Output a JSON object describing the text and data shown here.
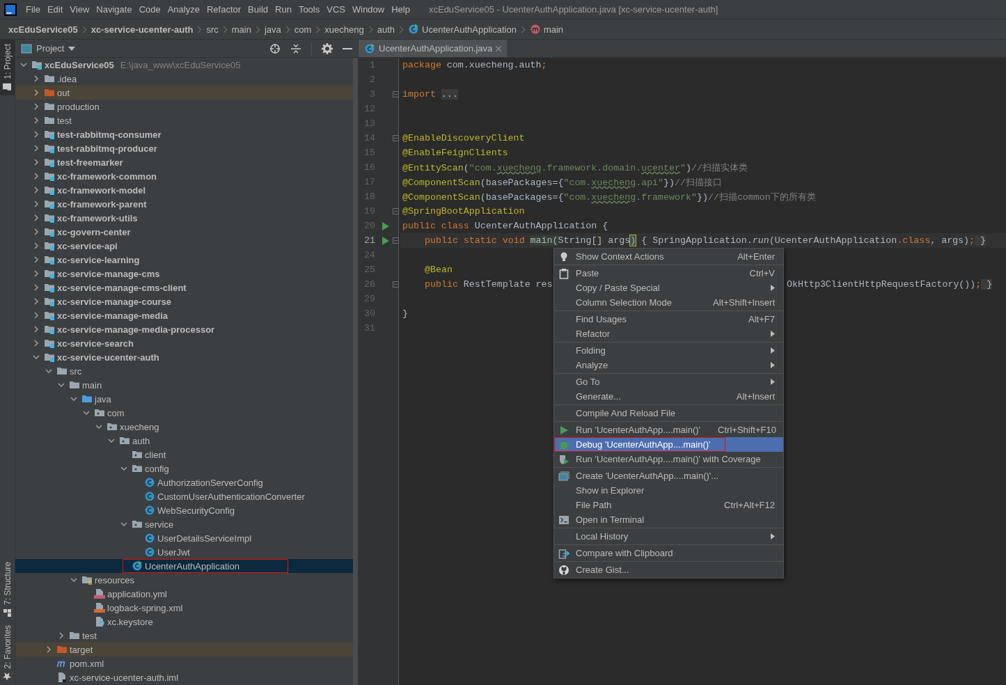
{
  "window": {
    "title": "xcEduService05 - UcenterAuthApplication.java [xc-service-ucenter-auth]"
  },
  "menubar": [
    "File",
    "Edit",
    "View",
    "Navigate",
    "Code",
    "Analyze",
    "Refactor",
    "Build",
    "Run",
    "Tools",
    "VCS",
    "Window",
    "Help"
  ],
  "breadcrumbs": [
    {
      "label": "xcEduService05",
      "kind": "module"
    },
    {
      "label": "xc-service-ucenter-auth",
      "kind": "module"
    },
    {
      "label": "src",
      "kind": "folder"
    },
    {
      "label": "main",
      "kind": "folder"
    },
    {
      "label": "java",
      "kind": "folder"
    },
    {
      "label": "com",
      "kind": "folder"
    },
    {
      "label": "xuecheng",
      "kind": "folder"
    },
    {
      "label": "auth",
      "kind": "folder"
    },
    {
      "label": "UcenterAuthApplication",
      "kind": "class"
    },
    {
      "label": "main",
      "kind": "method"
    }
  ],
  "tool_stripe": {
    "top": [
      {
        "label": "1: Project",
        "kind": "project",
        "selected": true
      }
    ],
    "bottom": [
      {
        "label": "7: Structure",
        "kind": "structure",
        "selected": false
      },
      {
        "label": "2: Favorites",
        "kind": "favorites",
        "selected": false
      }
    ]
  },
  "project": {
    "title": "Project",
    "tree": {
      "name": "xcEduService05",
      "path": "E:\\java_www\\xcEduService05",
      "kind": "module",
      "expanded": true,
      "selected": false,
      "outlined": false,
      "children": [
        {
          "name": ".idea",
          "kind": "folder",
          "expanded": false,
          "selected": false,
          "outlined": false
        },
        {
          "name": "out",
          "kind": "excluded",
          "expanded": false,
          "selected": false,
          "outlined": false
        },
        {
          "name": "production",
          "kind": "folder",
          "expanded": false,
          "selected": false,
          "outlined": false
        },
        {
          "name": "test",
          "kind": "folder",
          "expanded": false,
          "selected": false,
          "outlined": false
        },
        {
          "name": "test-rabbitmq-consumer",
          "kind": "module",
          "expanded": false,
          "selected": false,
          "outlined": false
        },
        {
          "name": "test-rabbitmq-producer",
          "kind": "module",
          "expanded": false,
          "selected": false,
          "outlined": false
        },
        {
          "name": "test-freemarker",
          "kind": "module",
          "expanded": false,
          "selected": false,
          "outlined": false
        },
        {
          "name": "xc-framework-common",
          "kind": "module",
          "expanded": false,
          "selected": false,
          "outlined": false
        },
        {
          "name": "xc-framework-model",
          "kind": "module",
          "expanded": false,
          "selected": false,
          "outlined": false
        },
        {
          "name": "xc-framework-parent",
          "kind": "module",
          "expanded": false,
          "selected": false,
          "outlined": false
        },
        {
          "name": "xc-framework-utils",
          "kind": "module",
          "expanded": false,
          "selected": false,
          "outlined": false
        },
        {
          "name": "xc-govern-center",
          "kind": "module",
          "expanded": false,
          "selected": false,
          "outlined": false
        },
        {
          "name": "xc-service-api",
          "kind": "module",
          "expanded": false,
          "selected": false,
          "outlined": false
        },
        {
          "name": "xc-service-learning",
          "kind": "module",
          "expanded": false,
          "selected": false,
          "outlined": false
        },
        {
          "name": "xc-service-manage-cms",
          "kind": "module",
          "expanded": false,
          "selected": false,
          "outlined": false
        },
        {
          "name": "xc-service-manage-cms-client",
          "kind": "module",
          "expanded": false,
          "selected": false,
          "outlined": false
        },
        {
          "name": "xc-service-manage-course",
          "kind": "module",
          "expanded": false,
          "selected": false,
          "outlined": false
        },
        {
          "name": "xc-service-manage-media",
          "kind": "module",
          "expanded": false,
          "selected": false,
          "outlined": false
        },
        {
          "name": "xc-service-manage-media-processor",
          "kind": "module",
          "expanded": false,
          "selected": false,
          "outlined": false
        },
        {
          "name": "xc-service-search",
          "kind": "module",
          "expanded": false,
          "selected": false,
          "outlined": false
        },
        {
          "name": "xc-service-ucenter-auth",
          "kind": "module",
          "expanded": true,
          "selected": false,
          "outlined": false,
          "children": [
            {
              "name": "src",
              "kind": "folder",
              "expanded": true,
              "selected": false,
              "outlined": false,
              "children": [
                {
                  "name": "main",
                  "kind": "folder",
                  "expanded": true,
                  "selected": false,
                  "outlined": false,
                  "children": [
                    {
                      "name": "java",
                      "kind": "source",
                      "expanded": true,
                      "selected": false,
                      "outlined": false,
                      "children": [
                        {
                          "name": "com",
                          "kind": "package",
                          "expanded": true,
                          "selected": false,
                          "outlined": false,
                          "children": [
                            {
                              "name": "xuecheng",
                              "kind": "package",
                              "expanded": true,
                              "selected": false,
                              "outlined": false,
                              "children": [
                                {
                                  "name": "auth",
                                  "kind": "package",
                                  "expanded": true,
                                  "selected": false,
                                  "outlined": false,
                                  "children": [
                                    {
                                      "name": "client",
                                      "kind": "package",
                                      "selected": false,
                                      "outlined": false
                                    },
                                    {
                                      "name": "config",
                                      "kind": "package",
                                      "expanded": true,
                                      "selected": false,
                                      "outlined": false,
                                      "children": [
                                        {
                                          "name": "AuthorizationServerConfig",
                                          "kind": "class",
                                          "selected": false,
                                          "outlined": false
                                        },
                                        {
                                          "name": "CustomUserAuthenticationConverter",
                                          "kind": "class",
                                          "selected": false,
                                          "outlined": false
                                        },
                                        {
                                          "name": "WebSecurityConfig",
                                          "kind": "class",
                                          "selected": false,
                                          "outlined": false
                                        }
                                      ]
                                    },
                                    {
                                      "name": "service",
                                      "kind": "package",
                                      "expanded": true,
                                      "selected": false,
                                      "outlined": false,
                                      "children": [
                                        {
                                          "name": "UserDetailsServiceImpl",
                                          "kind": "class",
                                          "selected": false,
                                          "outlined": false
                                        },
                                        {
                                          "name": "UserJwt",
                                          "kind": "class",
                                          "selected": false,
                                          "outlined": false
                                        }
                                      ]
                                    },
                                    {
                                      "name": "UcenterAuthApplication",
                                      "kind": "main-class",
                                      "selected": true,
                                      "outlined": true
                                    }
                                  ]
                                }
                              ]
                            }
                          ]
                        }
                      ]
                    },
                    {
                      "name": "resources",
                      "kind": "resources",
                      "expanded": true,
                      "selected": false,
                      "outlined": false,
                      "children": [
                        {
                          "name": "application.yml",
                          "kind": "yml",
                          "selected": false,
                          "outlined": false
                        },
                        {
                          "name": "logback-spring.xml",
                          "kind": "xml",
                          "selected": false,
                          "outlined": false
                        },
                        {
                          "name": "xc.keystore",
                          "kind": "keystore",
                          "selected": false,
                          "outlined": false
                        }
                      ]
                    }
                  ]
                },
                {
                  "name": "test",
                  "kind": "folder",
                  "expanded": false,
                  "selected": false,
                  "outlined": false
                }
              ]
            },
            {
              "name": "target",
              "kind": "excluded",
              "expanded": false,
              "selected": false,
              "outlined": false
            },
            {
              "name": "pom.xml",
              "kind": "maven",
              "selected": false,
              "outlined": false
            },
            {
              "name": "xc-service-ucenter-auth.iml",
              "kind": "iml",
              "selected": false,
              "outlined": false
            }
          ]
        }
      ]
    }
  },
  "editor": {
    "tabs": [
      {
        "label": "UcenterAuthApplication.java",
        "selected": true
      }
    ],
    "lines": [
      {
        "number": "1",
        "run": false,
        "fold": false,
        "current": false,
        "tokens": [
          {
            "kind": "kw",
            "text": "package "
          },
          {
            "kind": "txt",
            "text": "com.xuecheng.auth"
          },
          {
            "kind": "kw",
            "text": ";"
          }
        ]
      },
      {
        "number": "2",
        "run": false,
        "fold": false,
        "current": false
      },
      {
        "number": "3",
        "run": false,
        "fold": true,
        "current": false,
        "tokens": [
          {
            "kind": "kw",
            "text": "import "
          },
          {
            "kind": "folded",
            "text": "..."
          }
        ]
      },
      {
        "number": "12",
        "run": false,
        "fold": false,
        "current": false
      },
      {
        "number": "13",
        "run": false,
        "fold": false,
        "current": false
      },
      {
        "number": "14",
        "run": false,
        "fold": true,
        "current": false,
        "tokens": [
          {
            "kind": "ann",
            "text": "@EnableDiscoveryClient"
          }
        ]
      },
      {
        "number": "15",
        "run": false,
        "fold": false,
        "current": false,
        "tokens": [
          {
            "kind": "ann",
            "text": "@EnableFeignClients"
          }
        ]
      },
      {
        "number": "16",
        "run": false,
        "fold": false,
        "current": false,
        "tokens": [
          {
            "kind": "ann",
            "text": "@EntityScan"
          },
          {
            "kind": "txt",
            "text": "("
          },
          {
            "kind": "str",
            "text": "\"com."
          },
          {
            "kind": "strw",
            "text": "xuecheng"
          },
          {
            "kind": "str",
            "text": ".framework.domain."
          },
          {
            "kind": "strw",
            "text": "ucenter"
          },
          {
            "kind": "str",
            "text": "\""
          },
          {
            "kind": "txt",
            "text": ")"
          },
          {
            "kind": "cmt",
            "text": "//扫描实体类"
          }
        ]
      },
      {
        "number": "17",
        "run": false,
        "fold": false,
        "current": false,
        "tokens": [
          {
            "kind": "ann",
            "text": "@ComponentScan"
          },
          {
            "kind": "txt",
            "text": "(basePackages={"
          },
          {
            "kind": "str",
            "text": "\"com."
          },
          {
            "kind": "strw",
            "text": "xuecheng"
          },
          {
            "kind": "str",
            "text": ".api\""
          },
          {
            "kind": "txt",
            "text": "})"
          },
          {
            "kind": "cmt",
            "text": "//扫描接口"
          }
        ]
      },
      {
        "number": "18",
        "run": false,
        "fold": false,
        "current": false,
        "tokens": [
          {
            "kind": "ann",
            "text": "@ComponentScan"
          },
          {
            "kind": "txt",
            "text": "(basePackages={"
          },
          {
            "kind": "str",
            "text": "\"com."
          },
          {
            "kind": "strw",
            "text": "xuecheng"
          },
          {
            "kind": "str",
            "text": ".framework\""
          },
          {
            "kind": "txt",
            "text": "})"
          },
          {
            "kind": "cmt",
            "text": "//扫描common下的所有类"
          }
        ]
      },
      {
        "number": "19",
        "run": false,
        "fold": true,
        "current": false,
        "tokens": [
          {
            "kind": "ann",
            "text": "@SpringBootApplication"
          }
        ]
      },
      {
        "number": "20",
        "run": true,
        "fold": false,
        "current": false,
        "tokens": [
          {
            "kind": "kw",
            "text": "public class "
          },
          {
            "kind": "txt",
            "text": "UcenterAuthApplication {"
          }
        ]
      },
      {
        "number": "21",
        "run": true,
        "fold": true,
        "current": true,
        "indented": true,
        "tokens": [
          {
            "kind": "kw",
            "text": "public static void "
          },
          {
            "kind": "hl",
            "text": "main("
          },
          {
            "kind": "txt",
            "text": "String[] args"
          },
          {
            "kind": "brace",
            "text": ")"
          },
          {
            "kind": "txt",
            "text": " { SpringApplication."
          },
          {
            "kind": "it",
            "text": "run"
          },
          {
            "kind": "txt",
            "text": "(UcenterAuthApplication"
          },
          {
            "kind": "kw",
            "text": ".class"
          },
          {
            "kind": "txt",
            "text": ", args)"
          },
          {
            "kind": "kw",
            "text": ";"
          },
          {
            "kind": "folded",
            "text": " }"
          }
        ]
      },
      {
        "number": "24",
        "run": false,
        "fold": false,
        "current": false
      },
      {
        "number": "25",
        "run": false,
        "fold": false,
        "current": false,
        "indented": true,
        "tokens": [
          {
            "kind": "ann",
            "text": "@Bean"
          }
        ]
      },
      {
        "number": "26",
        "run": false,
        "fold": true,
        "current": false,
        "indented": true,
        "tokens": [
          {
            "kind": "kw",
            "text": "public "
          },
          {
            "kind": "txt",
            "text": "RestTemplate res"
          }
        ],
        "after_menu": [
          {
            "kind": "txt",
            "text": "OkHttp3ClientHttpRequestFactory())"
          },
          {
            "kind": "kw",
            "text": ";"
          },
          {
            "kind": "folded",
            "text": " }"
          }
        ]
      },
      {
        "number": "29",
        "run": false,
        "fold": false,
        "current": false
      },
      {
        "number": "30",
        "run": false,
        "fold": false,
        "current": false,
        "tokens": [
          {
            "kind": "txt",
            "text": "}"
          }
        ]
      },
      {
        "number": "31",
        "run": false,
        "fold": false,
        "current": false
      }
    ]
  },
  "context_menu": {
    "groups": [
      [
        {
          "label": "Show Context Actions",
          "shortcut": "Alt+Enter",
          "kind": "bulb",
          "submenu": false,
          "selected": false,
          "outlined": false
        }
      ],
      [
        {
          "label": "Paste",
          "shortcut": "Ctrl+V",
          "kind": "paste",
          "submenu": false,
          "selected": false,
          "outlined": false
        },
        {
          "label": "Copy / Paste Special",
          "kind": "plain",
          "submenu": true,
          "selected": false,
          "outlined": false
        },
        {
          "label": "Column Selection Mode",
          "shortcut": "Alt+Shift+Insert",
          "kind": "plain",
          "submenu": false,
          "selected": false,
          "outlined": false
        }
      ],
      [
        {
          "label": "Find Usages",
          "shortcut": "Alt+F7",
          "kind": "plain",
          "submenu": false,
          "selected": false,
          "outlined": false
        },
        {
          "label": "Refactor",
          "kind": "plain",
          "submenu": true,
          "selected": false,
          "outlined": false
        }
      ],
      [
        {
          "label": "Folding",
          "kind": "plain",
          "submenu": true,
          "selected": false,
          "outlined": false
        },
        {
          "label": "Analyze",
          "kind": "plain",
          "submenu": true,
          "selected": false,
          "outlined": false
        }
      ],
      [
        {
          "label": "Go To",
          "kind": "plain",
          "submenu": true,
          "selected": false,
          "outlined": false
        },
        {
          "label": "Generate...",
          "shortcut": "Alt+Insert",
          "kind": "plain",
          "submenu": false,
          "selected": false,
          "outlined": false
        }
      ],
      [
        {
          "label": "Compile And Reload File",
          "kind": "plain",
          "submenu": false,
          "selected": false,
          "outlined": false
        }
      ],
      [
        {
          "label": "Run 'UcenterAuthApp....main()'",
          "shortcut": "Ctrl+Shift+F10",
          "kind": "run",
          "submenu": false,
          "selected": false,
          "outlined": false
        },
        {
          "label": "Debug 'UcenterAuthApp....main()'",
          "kind": "debug",
          "submenu": false,
          "selected": true,
          "outlined": true
        },
        {
          "label": "Run 'UcenterAuthApp....main()' with Coverage",
          "kind": "coverage",
          "submenu": false,
          "selected": false,
          "outlined": false
        }
      ],
      [
        {
          "label": "Create 'UcenterAuthApp....main()'...",
          "kind": "config",
          "submenu": false,
          "selected": false,
          "outlined": false
        },
        {
          "label": "Show in Explorer",
          "kind": "plain",
          "submenu": false,
          "selected": false,
          "outlined": false
        },
        {
          "label": "File Path",
          "shortcut": "Ctrl+Alt+F12",
          "kind": "plain",
          "submenu": false,
          "selected": false,
          "outlined": false
        },
        {
          "label": "Open in Terminal",
          "kind": "terminal",
          "submenu": false,
          "selected": false,
          "outlined": false
        }
      ],
      [
        {
          "label": "Local History",
          "kind": "plain",
          "submenu": true,
          "selected": false,
          "outlined": false
        }
      ],
      [
        {
          "label": "Compare with Clipboard",
          "kind": "compare",
          "submenu": false,
          "selected": false,
          "outlined": false
        }
      ],
      [
        {
          "label": "Create Gist...",
          "kind": "gist",
          "submenu": false,
          "selected": false,
          "outlined": false
        }
      ]
    ]
  }
}
